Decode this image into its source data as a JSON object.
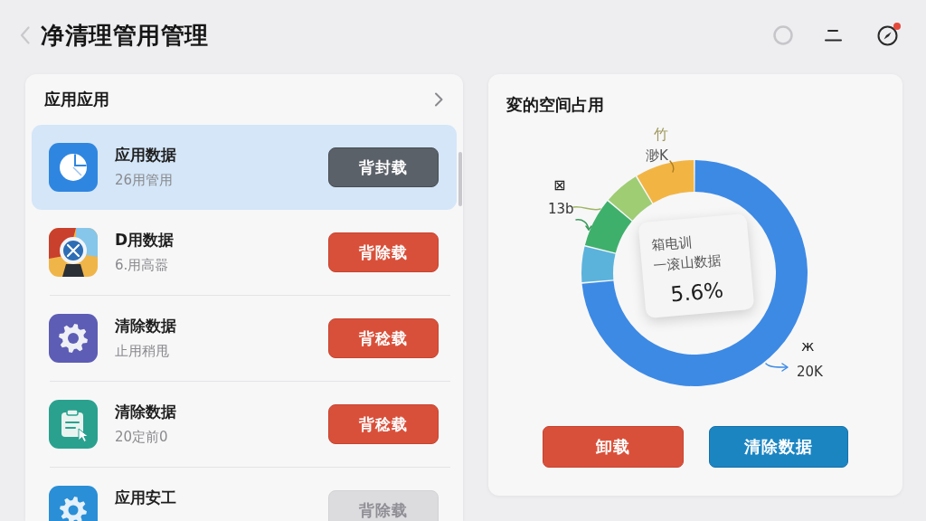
{
  "header": {
    "title": "净清理管用管理",
    "has_notification": true
  },
  "apps_panel": {
    "title": "应用应用",
    "rows": [
      {
        "title": "应用数据",
        "subtitle": "26用管用",
        "selected": true,
        "button": {
          "label": "背封载",
          "disabled": false
        }
      },
      {
        "title": "D用数据",
        "subtitle": "6.用高嚣",
        "selected": false,
        "button": {
          "label": "背除载",
          "disabled": false
        }
      },
      {
        "title": "清除数据",
        "subtitle": "止用稍甩",
        "selected": false,
        "button": {
          "label": "背稔载",
          "disabled": false
        }
      },
      {
        "title": "清除数据",
        "subtitle": "20定前0",
        "selected": false,
        "button": {
          "label": "背稔载",
          "disabled": false
        }
      },
      {
        "title": "应用安工",
        "selected": false,
        "button": {
          "label": "背除载",
          "disabled": true
        }
      }
    ]
  },
  "usage_panel": {
    "title": "変的空间占用",
    "segments": [
      {
        "color": "#3d8ae5"
      },
      {
        "color": "#5bb3db"
      },
      {
        "color": "#3fb06c"
      },
      {
        "color": "#9fcd74"
      },
      {
        "color": "#f2b544"
      }
    ],
    "labels": [
      {
        "symbol": "竹",
        "value": "渺K"
      },
      {
        "symbol": "⊠",
        "value": "13b"
      },
      {
        "symbol": "ж",
        "value": "20K"
      }
    ],
    "callout": {
      "lines": [
        "箱电训",
        "一滚山数据"
      ],
      "value": "5.6%"
    },
    "buttons": [
      {
        "label": "卸载",
        "kind": "danger"
      },
      {
        "label": "清除数据",
        "kind": "primary"
      }
    ]
  }
}
